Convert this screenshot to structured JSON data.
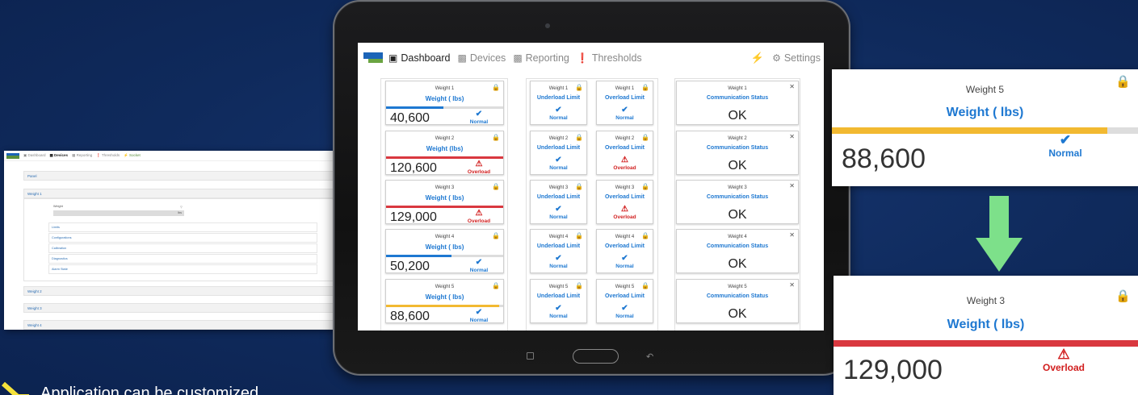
{
  "desktop": {
    "nav": {
      "items": [
        "Dashboard",
        "Devices",
        "Reporting",
        "Thresholds",
        "Socket"
      ],
      "settings": "Settings"
    },
    "panel_label": "Panel",
    "weight1": {
      "header": "Weight 1",
      "field_label": "Weight",
      "unit": "lbs"
    },
    "links": [
      "Limits",
      "Configurations",
      "Calibration",
      "Diagnostics",
      "Alarm State"
    ],
    "sections": [
      "Weight 2",
      "Weight 3",
      "Weight 4"
    ]
  },
  "tablet": {
    "nav": {
      "dashboard": "Dashboard",
      "devices": "Devices",
      "reporting": "Reporting",
      "thresholds": "Thresholds",
      "settings": "Settings"
    },
    "weights": [
      {
        "name": "Weight 1",
        "unit_label": "Weight ( lbs)",
        "value": "40,600",
        "status": "Normal",
        "bar_fraction": 0.48,
        "bar_color": "#1e78d1"
      },
      {
        "name": "Weight 2",
        "unit_label": "Weight (lbs)",
        "value": "120,600",
        "status": "Overload",
        "bar_fraction": 1.0,
        "bar_color": "#d9383f"
      },
      {
        "name": "Weight 3",
        "unit_label": "Weight ( lbs)",
        "value": "129,000",
        "status": "Overload",
        "bar_fraction": 1.0,
        "bar_color": "#d9383f"
      },
      {
        "name": "Weight 4",
        "unit_label": "Weight ( lbs)",
        "value": "50,200",
        "status": "Normal",
        "bar_fraction": 0.55,
        "bar_color": "#1e78d1"
      },
      {
        "name": "Weight 5",
        "unit_label": "Weight ( lbs)",
        "value": "88,600",
        "status": "Normal",
        "bar_fraction": 0.95,
        "bar_color": "#f2b931"
      }
    ],
    "underload": [
      {
        "name": "Weight 1",
        "label": "Underload Limit",
        "status": "Normal"
      },
      {
        "name": "Weight 2",
        "label": "Underload Limit",
        "status": "Normal"
      },
      {
        "name": "Weight 3",
        "label": "Underload Limit",
        "status": "Normal"
      },
      {
        "name": "Weight 4",
        "label": "Underload Limit",
        "status": "Normal"
      },
      {
        "name": "Weight 5",
        "label": "Underload Limit",
        "status": "Normal"
      }
    ],
    "overload": [
      {
        "name": "Weight 1",
        "label": "Overload Limit",
        "status": "Normal"
      },
      {
        "name": "Weight 2",
        "label": "Overload Limit",
        "status": "Overload"
      },
      {
        "name": "Weight 3",
        "label": "Overload Limit",
        "status": "Overload"
      },
      {
        "name": "Weight 4",
        "label": "Overload Limit",
        "status": "Normal"
      },
      {
        "name": "Weight 5",
        "label": "Overload Limit",
        "status": "Normal"
      }
    ],
    "comm": [
      {
        "name": "Weight 1",
        "label": "Communication Status",
        "value": "OK"
      },
      {
        "name": "Weight 2",
        "label": "Communication Status",
        "value": "OK"
      },
      {
        "name": "Weight 3",
        "label": "Communication Status",
        "value": "OK"
      },
      {
        "name": "Weight 4",
        "label": "Communication Status",
        "value": "OK"
      },
      {
        "name": "Weight 5",
        "label": "Communication Status",
        "value": "OK"
      }
    ]
  },
  "callout_top": {
    "name": "Weight 5",
    "unit_label": "Weight ( lbs)",
    "value": "88,600",
    "status": "Normal",
    "bar_fraction": 0.9,
    "bar_color": "#f2b931"
  },
  "callout_bottom": {
    "name": "Weight 3",
    "unit_label": "Weight ( lbs)",
    "value": "129,000",
    "status": "Overload",
    "bar_fraction": 1.0,
    "bar_color": "#d9383f"
  },
  "caption": "Application can be customized",
  "colors": {
    "normal": "#1e78d1",
    "overload": "#d11e1e",
    "arrow": "#7de08a",
    "chevron": "#f5e23b"
  }
}
